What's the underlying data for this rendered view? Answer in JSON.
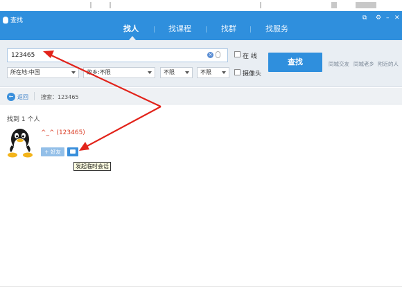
{
  "window": {
    "app_title": "查找",
    "controls": [
      "⧉",
      "⚙",
      "–",
      "✕"
    ]
  },
  "tabs": [
    {
      "label": "找人",
      "active": true
    },
    {
      "label": "找课程",
      "active": false
    },
    {
      "label": "找群",
      "active": false
    },
    {
      "label": "找服务",
      "active": false
    }
  ],
  "search": {
    "query": "123465",
    "online_label": "在 线",
    "camera_label": "摄像头",
    "button_label": "查找",
    "filters": [
      {
        "value": "所在地:中国"
      },
      {
        "value": "故乡:不限"
      },
      {
        "value": "不限"
      },
      {
        "value": "不限"
      }
    ],
    "quick_links": [
      "同城交友",
      "同城老乡",
      "附近的人"
    ]
  },
  "breadcrumb": {
    "back_label": "返回",
    "search_text": "搜索：123465"
  },
  "results": {
    "count_text": "找到 1 个人",
    "users": [
      {
        "name": "^_^ (123465)",
        "add_friend_label": "+ 好友",
        "chat_tooltip": "发起临时会话"
      }
    ]
  },
  "colors": {
    "accent": "#2f8fdd",
    "annotation_arrow": "#e2231a",
    "name_red": "#d9361e"
  }
}
